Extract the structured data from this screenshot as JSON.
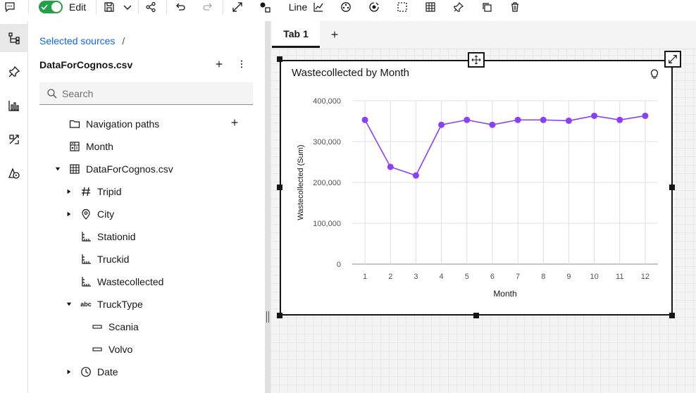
{
  "toolbar": {
    "mode_label": "Edit",
    "viz_type_label": "Line"
  },
  "panel": {
    "breadcrumb_link": "Selected sources",
    "breadcrumb_sep": "/",
    "source_name": "DataForCognos.csv",
    "search_placeholder": "Search",
    "items": [
      {
        "label": "Navigation paths",
        "icon": "folder-icon"
      },
      {
        "label": "Month",
        "icon": "calculation-icon"
      },
      {
        "label": "DataForCognos.csv",
        "icon": "table-icon"
      },
      {
        "label": "Tripid",
        "icon": "hash-icon"
      },
      {
        "label": "City",
        "icon": "location-icon"
      },
      {
        "label": "Stationid",
        "icon": "measure-icon"
      },
      {
        "label": "Truckid",
        "icon": "measure-icon"
      },
      {
        "label": "Wastecollected",
        "icon": "measure-icon"
      },
      {
        "label": "TruckType",
        "icon": "abc-icon"
      },
      {
        "label": "Scania",
        "icon": "member-icon"
      },
      {
        "label": "Volvo",
        "icon": "member-icon"
      },
      {
        "label": "Date",
        "icon": "clock-icon"
      }
    ],
    "abc_text": "abc"
  },
  "tabs": [
    {
      "label": "Tab 1"
    }
  ],
  "chart_data": {
    "type": "line",
    "title": "Wastecollected by Month",
    "xlabel": "Month",
    "ylabel": "Wastecollected (Sum)",
    "categories": [
      "1",
      "2",
      "3",
      "4",
      "5",
      "6",
      "7",
      "8",
      "9",
      "10",
      "11",
      "12"
    ],
    "values": [
      353000,
      238000,
      217000,
      341000,
      353000,
      341000,
      353000,
      353000,
      351000,
      363000,
      353000,
      363000
    ],
    "ylim": [
      0,
      400000
    ],
    "yticks": [
      "0",
      "100,000",
      "200,000",
      "300,000",
      "400,000"
    ],
    "color": "#8a3ffc",
    "grid": true
  }
}
